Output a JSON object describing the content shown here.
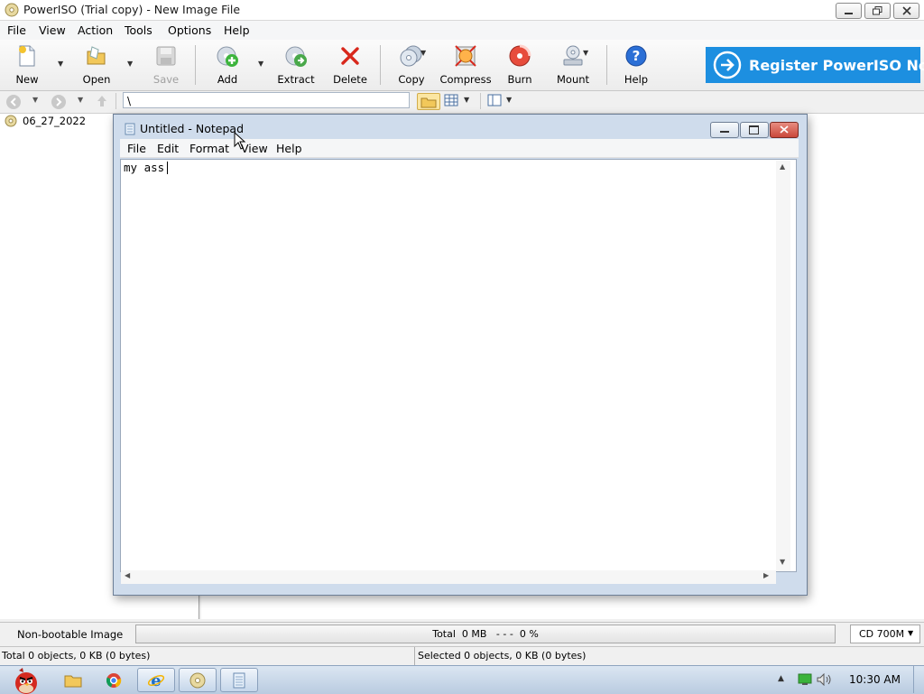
{
  "app": {
    "title": "PowerISO (Trial copy) - New Image File",
    "menu": [
      "File",
      "View",
      "Action",
      "Tools",
      "Options",
      "Help"
    ]
  },
  "toolbar": {
    "new_label": "New",
    "open_label": "Open",
    "save_label": "Save",
    "add_label": "Add",
    "extract_label": "Extract",
    "delete_label": "Delete",
    "copy_label": "Copy",
    "compress_label": "Compress",
    "burn_label": "Burn",
    "mount_label": "Mount",
    "help_label": "Help"
  },
  "register_banner": "Register PowerISO Now",
  "address": {
    "value": "\\"
  },
  "tree": {
    "root_label": "06_27_2022"
  },
  "status": {
    "boot_type": "Non-bootable Image",
    "progress_text": "Total  0 MB   - - -  0 %",
    "media_size": "CD 700M",
    "total_objects": "Total 0 objects, 0 KB (0 bytes)",
    "selected_objects": "Selected 0 objects, 0 KB (0 bytes)"
  },
  "notepad": {
    "title": "Untitled - Notepad",
    "menu": [
      "File",
      "Edit",
      "Format",
      "View",
      "Help"
    ],
    "content": "my ass"
  },
  "taskbar": {
    "clock": "10:30 AM"
  },
  "colors": {
    "register_banner_bg": "#1d8fe0",
    "close_button": "#c9483b",
    "taskbar": "#c8d8ea"
  }
}
